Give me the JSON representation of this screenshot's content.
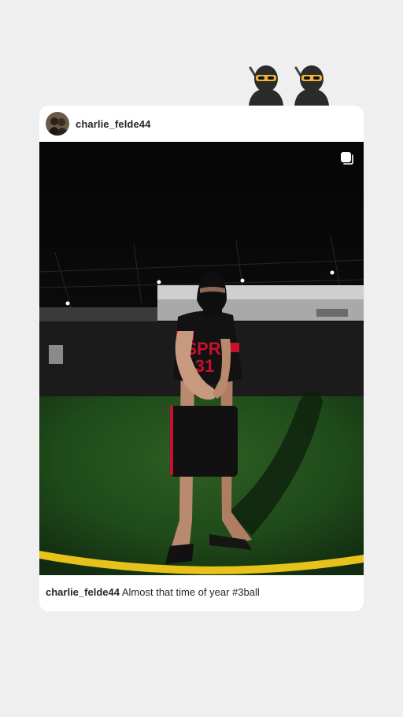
{
  "stickers": [
    {
      "icon": "ninja-emoji"
    },
    {
      "icon": "ninja-emoji"
    }
  ],
  "post": {
    "username": "charlie_felde44",
    "avatar_icon": "profile-avatar",
    "multi_icon": "carousel-icon",
    "caption": {
      "username": "charlie_felde44",
      "text": "Almost that time of year #3ball"
    }
  },
  "colors": {
    "background": "#efefef",
    "card": "#ffffff",
    "text": "#262626",
    "turf": "#1f4a1a",
    "field_line": "#e6c21a",
    "jersey_red": "#c8102e"
  }
}
